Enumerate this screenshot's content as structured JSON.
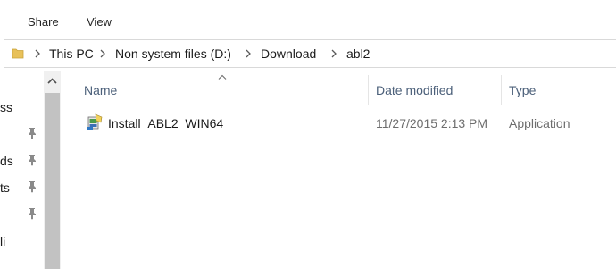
{
  "ribbon": {
    "tabs": [
      {
        "label": "Share"
      },
      {
        "label": "View"
      }
    ]
  },
  "address": {
    "crumbs": [
      "This PC",
      "Non system files (D:)",
      "Download",
      "abl2"
    ]
  },
  "nav": {
    "items": [
      {
        "label": "ss",
        "pinned": false
      },
      {
        "label": "ds",
        "pinned": true
      },
      {
        "label": "ts",
        "pinned": true
      },
      {
        "label": "li",
        "pinned": false
      }
    ],
    "pins": 4
  },
  "columns": {
    "name": "Name",
    "date": "Date modified",
    "type": "Type"
  },
  "files": [
    {
      "name": "Install_ABL2_WIN64",
      "date": "11/27/2015 2:13 PM",
      "type": "Application",
      "icon": "installer-icon"
    }
  ],
  "colors": {
    "header_text": "#4c607a",
    "folder": "#e8c15a",
    "scroll_thumb": "#c2c2c2"
  }
}
